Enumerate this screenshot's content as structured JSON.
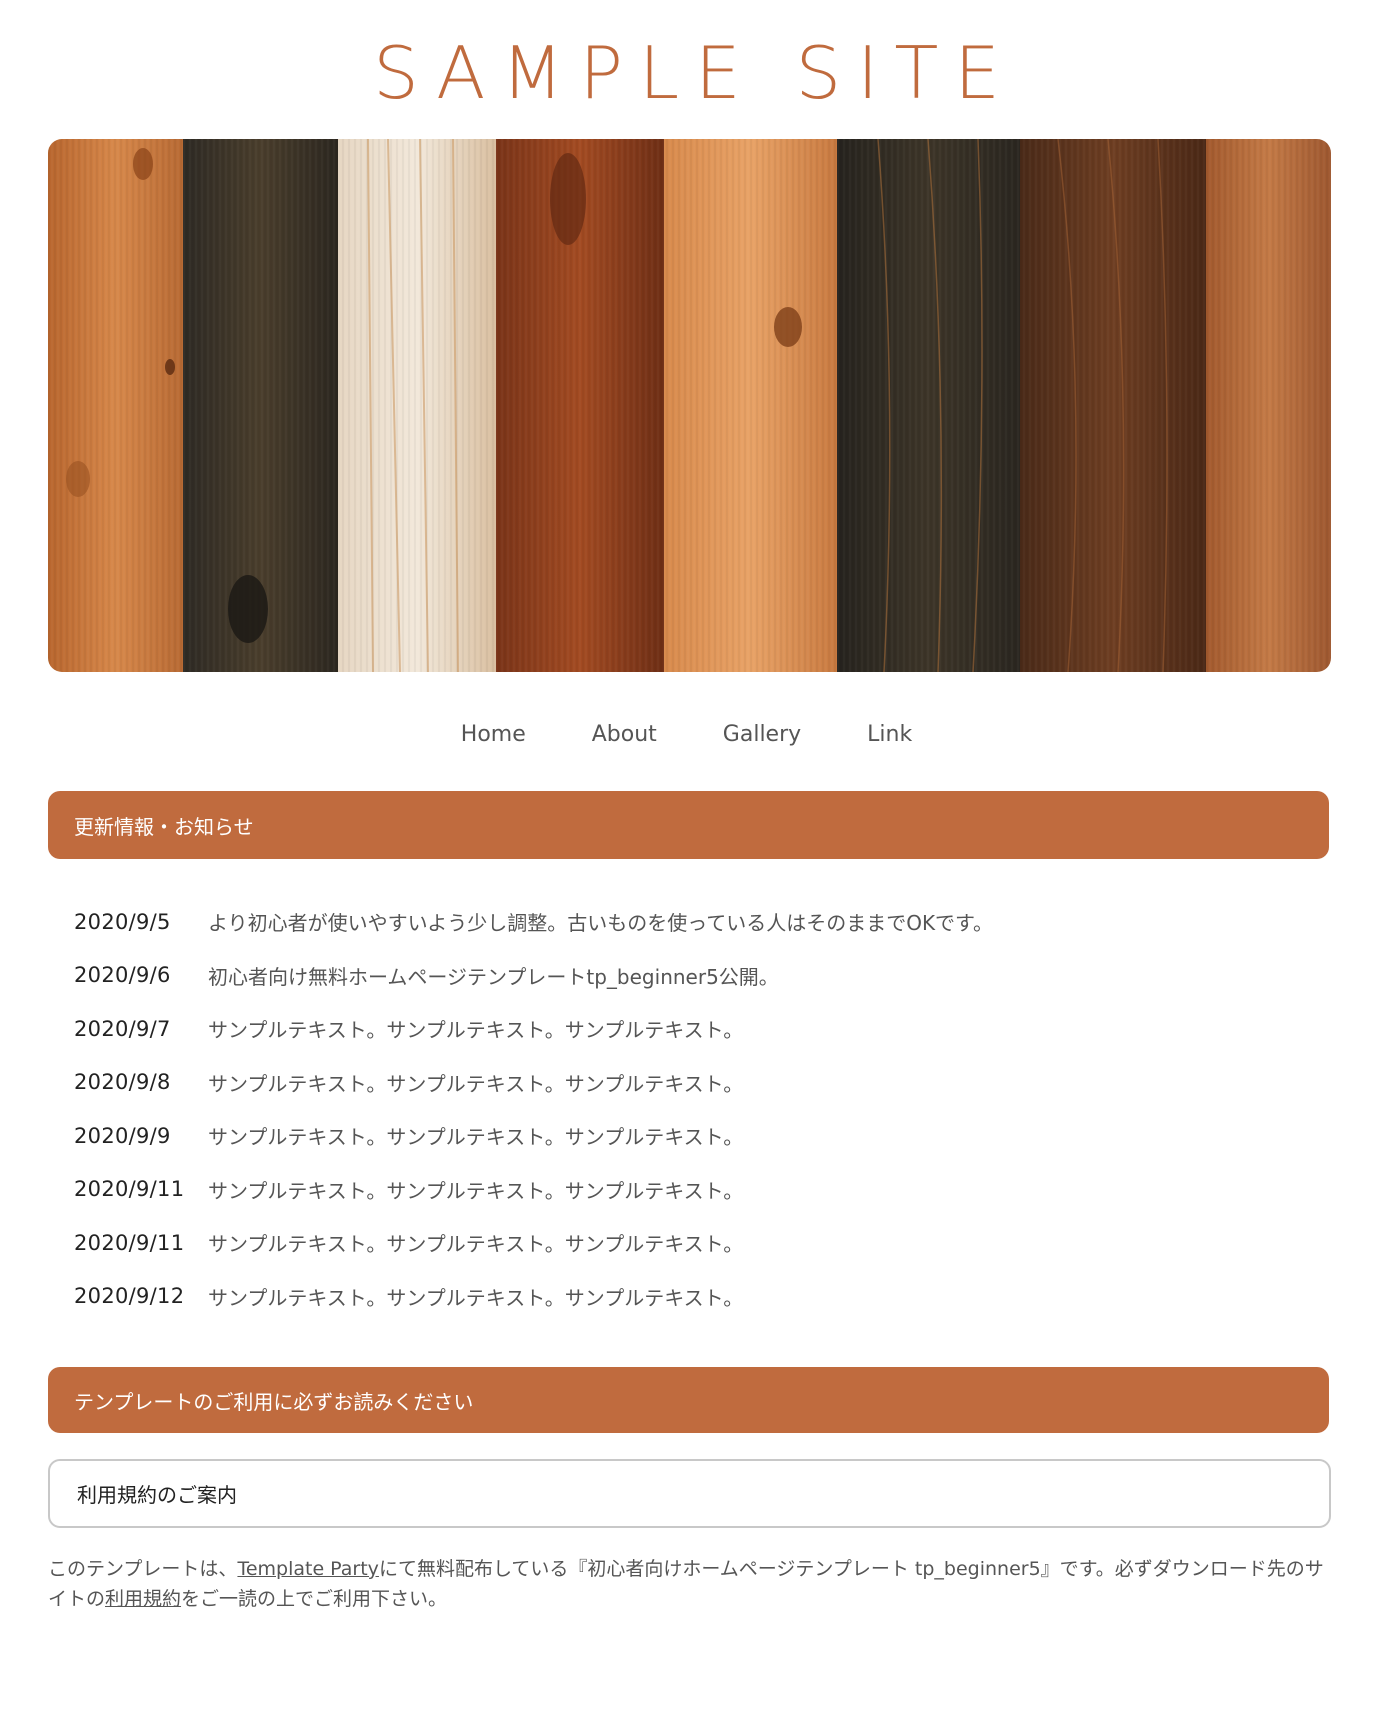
{
  "site": {
    "logo": "SAMPLE SITE",
    "accent_color": "#c06b3e"
  },
  "hero": {
    "image_description": "wooden-planks-photo"
  },
  "nav": {
    "items": [
      {
        "label": "Home"
      },
      {
        "label": "About"
      },
      {
        "label": "Gallery"
      },
      {
        "label": "Link"
      }
    ]
  },
  "news": {
    "heading": "更新情報・お知らせ",
    "items": [
      {
        "date": "2020/9/5",
        "text": "より初心者が使いやすいよう少し調整。古いものを使っている人はそのままでOKです。"
      },
      {
        "date": "2020/9/6",
        "text": "初心者向け無料ホームページテンプレートtp_beginner5公開。"
      },
      {
        "date": "2020/9/7",
        "text": "サンプルテキスト。サンプルテキスト。サンプルテキスト。"
      },
      {
        "date": "2020/9/8",
        "text": "サンプルテキスト。サンプルテキスト。サンプルテキスト。"
      },
      {
        "date": "2020/9/9",
        "text": "サンプルテキスト。サンプルテキスト。サンプルテキスト。"
      },
      {
        "date": "2020/9/11",
        "text": "サンプルテキスト。サンプルテキスト。サンプルテキスト。"
      },
      {
        "date": "2020/9/11",
        "text": "サンプルテキスト。サンプルテキスト。サンプルテキスト。"
      },
      {
        "date": "2020/9/12",
        "text": "サンプルテキスト。サンプルテキスト。サンプルテキスト。"
      }
    ]
  },
  "template_notice": {
    "heading": "テンプレートのご利用に必ずお読みください",
    "terms_box_label": "利用規約のご案内",
    "note": {
      "part1": "このテンプレートは、",
      "link1": "Template Party",
      "part2": "にて無料配布している『初心者向けホームページテンプレート tp_beginner5』です。必ずダウンロード先のサイトの",
      "link2": "利用規約",
      "part3": "をご一読の上でご利用下さい。"
    }
  }
}
